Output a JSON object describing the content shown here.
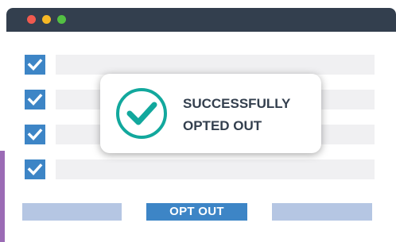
{
  "window": {
    "controls": {
      "close_color": "#f05a4f",
      "minimize_color": "#f6b825",
      "maximize_color": "#53c043"
    }
  },
  "checklist": {
    "items": [
      {
        "checked": true
      },
      {
        "checked": true
      },
      {
        "checked": true
      },
      {
        "checked": true
      }
    ]
  },
  "footer": {
    "opt_out_label": "OPT OUT"
  },
  "toast": {
    "line1": "SUCCESSFULLY",
    "line2": "OPTED OUT",
    "icon": "check-circle-icon",
    "accent_color": "#12a89d"
  },
  "colors": {
    "titlebar": "#333f4e",
    "checkbox": "#3d85c6",
    "placeholder_bar": "#f0f0f2",
    "footer_bar": "#b5c6e3",
    "button": "#3d85c6",
    "side_accent": "#9b6bb5"
  }
}
